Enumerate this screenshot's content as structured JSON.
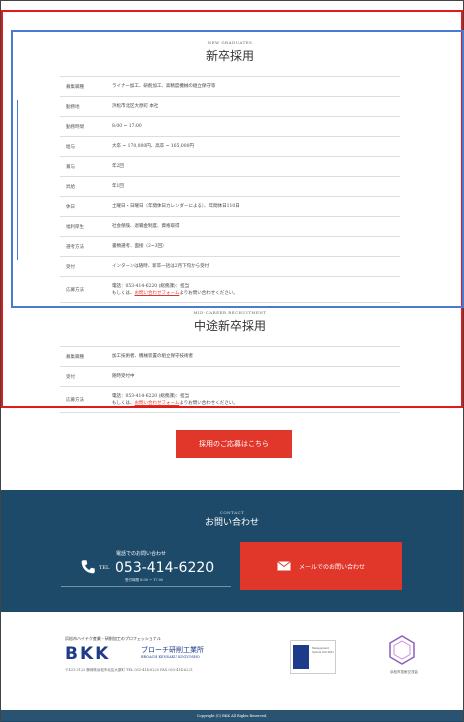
{
  "new_grad": {
    "subtitle": "NEW GRADUATES",
    "title": "新卒採用",
    "rows": [
      {
        "key": "募集職種",
        "value": "ライナー加工、研削加工、高精度機械の組立保守等"
      },
      {
        "key": "勤務地",
        "value": "浜松市北区大原町 本社"
      },
      {
        "key": "勤務時間",
        "value": "8:00 ~ 17:00"
      },
      {
        "key": "給与",
        "value": "大卒 ~ 170,000円、高卒 ~ 165,000円"
      },
      {
        "key": "賞与",
        "value": "年2回"
      },
      {
        "key": "昇給",
        "value": "年1回"
      },
      {
        "key": "休日",
        "value": "土曜日・日曜日（年間休日カレンダーによる）、年間休日110日"
      },
      {
        "key": "福利厚生",
        "value": "社会保険、退職金制度、資格取得"
      },
      {
        "key": "選考方法",
        "value": "書類選考、面接（2~3回）"
      },
      {
        "key": "受付",
        "value": "インターンは随時、新卒一括は2月下旬から受付"
      },
      {
        "key": "応募方法",
        "value": "電話：053-414-6220 (総務課)：担当",
        "value2_pre": "もしくは、",
        "value2_link": "お問い合わせフォーム",
        "value2_post": "よりお問い合わせください。"
      }
    ]
  },
  "mid_career": {
    "subtitle": "MID-CAREER RECRUITMENT",
    "title": "中途新卒採用",
    "rows": [
      {
        "key": "募集職種",
        "value": "加工技術者、機械装置の組立保守技術者"
      },
      {
        "key": "受付",
        "value": "随時受付中"
      },
      {
        "key": "応募方法",
        "value": "電話：053-414-6220 (総務課)：担当",
        "value2_pre": "もしくは、",
        "value2_link": "お問い合わせフォーム",
        "value2_post": "よりお問い合わせください。"
      }
    ]
  },
  "apply_button": "採用のご応募はこちら",
  "contact": {
    "subtitle": "CONTACT",
    "title": "お問い合わせ",
    "phone_label": "電話でのお問い合わせ",
    "tel_prefix": "TEL",
    "phone_number": "053-414-6220",
    "hours": "受付時間 8:00 ~ 17:00",
    "mail_button": "メールでのお問い合わせ"
  },
  "footer": {
    "tagline": "浜松市ハイテク産業・研削加工のプロフェッショナル",
    "logo": "BKK",
    "company_name": "ブローチ研削工業所",
    "company_name_en": "BROACH KENSAKU KOGYOSHO",
    "address": "〒431-3122 静岡県浜松市北区大原町 TEL 053-414-6220 FAX 053-414-6221",
    "iso_text": "Management System ISO 9001",
    "partner_label": "浜松市技術交流会"
  },
  "copyright": "Copyright (C) BKK All Rights Reserved."
}
